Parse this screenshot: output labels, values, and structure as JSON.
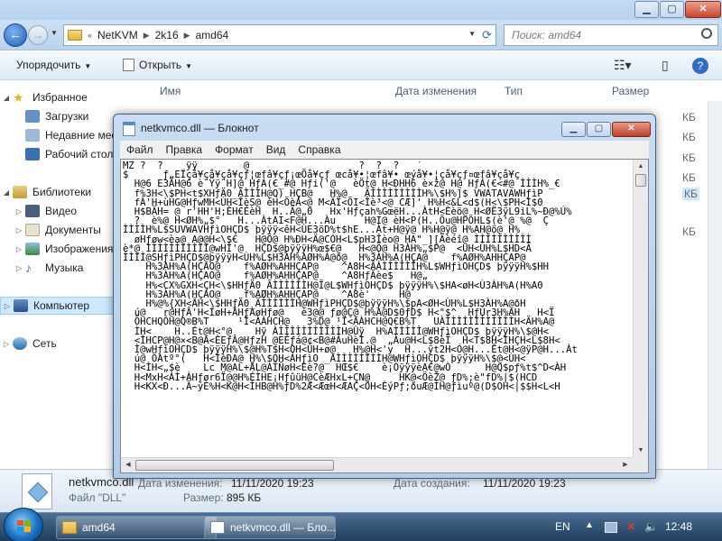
{
  "explorer": {
    "breadcrumb": [
      "NetKVM",
      "2k16",
      "amd64"
    ],
    "search_placeholder": "Поиск: amd64",
    "toolbar": {
      "organize": "Упорядочить",
      "open": "Открыть"
    },
    "columns": {
      "name": "Имя",
      "date": "Дата изменения",
      "type": "Тип",
      "size": "Размер"
    },
    "sizes": [
      "КБ",
      "КБ",
      "КБ",
      "КБ",
      "КБ",
      "КБ"
    ],
    "sidebar": {
      "favorites": "Избранное",
      "downloads": "Загрузки",
      "recent": "Недавние места",
      "desktop": "Рабочий стол",
      "libraries": "Библиотеки",
      "video": "Видео",
      "documents": "Документы",
      "images": "Изображения",
      "music": "Музыка",
      "computer": "Компьютер",
      "network": "Сеть"
    },
    "details": {
      "filename": "netkvmco.dll",
      "modified_label": "Дата изменения:",
      "modified_value": "11/11/2020 19:23",
      "created_label": "Дата создания:",
      "created_value": "11/11/2020 19:23",
      "type_label": "Файл \"DLL\"",
      "size_label": "Размер:",
      "size_value": "895 КБ"
    }
  },
  "notepad": {
    "title": "netkvmco.dll — Блокнот",
    "menu": [
      "Файл",
      "Правка",
      "Формат",
      "Вид",
      "Справка"
    ],
    "lines": [
      "MZ ?  ?    ÿÿ        @                   ?  ?  ?   ´",
      "$      ƒ„ЕΪçå¥çå¥çå¥çƒ¦œfâ¥çƒ¡œÕå¥çƒ œcå¥•¦œfâ¥• œýå¥•¦çå¥çƒ¤œfâ¥çå¥ç",
      "  H@6 E3ÀH@6 è¨Ÿÿ¨H]@ HƒÁ(€_#@ Hƒi('@   èÖt@ H<ÐHH6 è×ž@ H@ HƒÁ(€<#@ ÌÌÌH%_€",
      "  f%3H<\\$PH<t$XHƒÄ0_ÃÌÌÌH@Q) HÇB@   H%@   ÃÌÌÌÌÌÌÌÌÌH%\\$H%]$ VWATAVAWHƒìP",
      "  fÀ'H+ùHG@HƒwMH<ÙH<ÎèS@ èH<ÕèÁ<@ M<ÄÏ<ÕI<Îè³<@ CÆ]' H%H<&L<d$(H<\\$PH<Ì$0",
      "  H$BÄH= @ r'HH'H;ÈH€ÉèH  H..Ä@„0   Hx'Hƒçah%GœëH...ÀtH<Èèö@ H<ØË3ÿL9iL%~Ð@%Ú%",
      "  ?  è%@ H<ØH%„$°   H...ÀtAI<F@H...Àu     H@I@ èH<P(H..Õu@HPÖHL$(è'@ %@  Ç",
      "ÌÌÌÌH%L$SUVWAVHƒìOHÇD$ þÿÿÿ<êH<ÙE3öD%t$hE...Àt+H@ÿ@ H%H@ÿ@ H%AH@ö@ H%",
      "  øHƒøw<èa@ A@@H<\\$€   H@Ö@ H%ÐH<Ä@CÓH<L$pH3Îèo@ HA\"_][Äèéî@ ÌÌÌÌÌÌÌÌÌÌ",
      "è*@ ÌÌÌÌÌÌÌÌÌÌÌ@wHÌ'@  HÇD$@þÿÿÿH%œ$€@   H<@Ö@ H3ÀH%„$P@  <ÙH<ÙH%L$HD<Ã",
      "ÌÌÌÌ@SHƒìPHÇD$@þÿÿÿH<ÙH%L$H3ÀH%AØH%A@ð@  H%3ÀH%A(HÇA@    f%AØH%AHHÇAP@",
      "    H%3ÀH%A(HÇAO@    f%AØH%AHHÇAP@    ^A8H<ÂÀÌÌÌÌÌÌH%L$WHƒìOHÇD$ þÿÿÿH%$HH",
      "    H%3ÀH%A(HÇAO@    f%AØH%AHHÇAP@    ^A8HƒÃèe$   H@„",
      "    H%<CX%GXH<ÇH<\\$HHƒÄ0_ÃÌÌÌÌÌÌH@Ï@L$WHƒìOHÇD$ þÿÿÿH%\\$HA<øH<Ù3ÀH%A(H%A0",
      "    H%3ÀH%A(HÇAO@    f%AØH%AHHÇAP@    ^A8è'     H@",
      "    H%@%{XH<ÂH<\\$HHƒÄ0_ÃÌÌÌÌÌÌH@WHƒìPHÇD$@þÿÿÿH%\\$pA<ØH<ÙH%L$H3ÀH%A@ðH",
      "  ú@   r@HƒÂ'H<ÍøH+ÂHƒÀøHƒø@   è3@@ ƒø@Ç@ H%A@D$0ƒD$ H<\"$^  HƒÚr3H%AH   H<Ï",
      "  ÕHCHQÔH@Q®B%T     ¹Ï<ÀÀHCH@   3%D@ ¹Ï<ÀÀHCH@Q€B%T   UÀÌÌÌÌÌÌÌÌÌÌÌÌH<ÄH%A@",
      "  ÌH<    H..Ét@H<°@    Hÿ ÀÌÌÌÌÌÌÌÌÌÌÌH@Ûÿ  H%AÌÌÌÌÌ@WHƒìOHÇD$ þÿÿÿH%\\$@H<",
      "  <ÌHCP@H@×<B@À<ÈEƒÂ@HƒzH @EÉƒá@¢<B@#ÁuHèÌ.@  „Àu@H<L$8èÏ  H<T$8H<ÌHÇH<L$8H<",
      "  Ì@wHƒìOHÇD$ þÿÿÿH%\\$@H%T$H<ÒH<ÙH+ø@   H%@H<'y  H...ÿt2H<Ó@H...Êt@H<@ÿP@H...Àt",
      "  ú@ ÕAtº°(   H<ÍèÐA@ H%\\$OH<ÁHƒìO _ÀÌÌÌÌÌÌÌÌH@WHƒìOHÇD$ þÿÿÿH%\\$@<ÙH<",
      "  H<ÌH<„$è    Lc M@AL+ÅL@AÏÑøH<Èè?@  HŒ$€    è¡ÒÿÿÿèA€@wÒ      H@Q$pƒ%t$^D<ÀH",
      "  H<MxH<ÀÌ+ÀHƒør6Ï@@H%ÉÌHE¡HƒûüH@CèÆHxL+ÇN@     HK@<ÖèŽ@ ƒD%;è\"fD%|$(HCD",
      "  H<KX<Ð...Ã~ýÈ%H<K@H<ÌHB@H%ƒD%2Æ<ÆœH<ÆAÇ<ÖH<ÈýPƒ;ðuÆ@ÌH@ƒìuº@(D$OH<|$$H<L<H"
    ]
  },
  "taskbar": {
    "tasks": [
      "amd64",
      "netkvmco.dll — Бло..."
    ],
    "lang": "EN",
    "time": "12:48"
  }
}
